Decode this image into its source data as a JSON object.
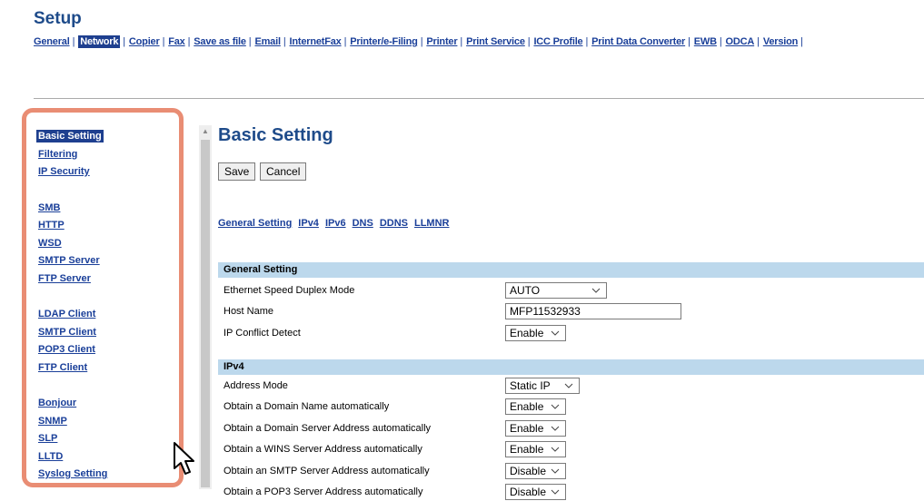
{
  "setup_title": "Setup",
  "top_nav": [
    {
      "label": "General",
      "active": false
    },
    {
      "label": "Network",
      "active": true
    },
    {
      "label": "Copier",
      "active": false
    },
    {
      "label": "Fax",
      "active": false
    },
    {
      "label": "Save as file",
      "active": false
    },
    {
      "label": "Email",
      "active": false
    },
    {
      "label": "InternetFax",
      "active": false
    },
    {
      "label": "Printer/e-Filing",
      "active": false
    },
    {
      "label": "Printer",
      "active": false
    },
    {
      "label": "Print Service",
      "active": false
    },
    {
      "label": "ICC Profile",
      "active": false
    },
    {
      "label": "Print Data Converter",
      "active": false
    },
    {
      "label": "EWB",
      "active": false
    },
    {
      "label": "ODCA",
      "active": false
    },
    {
      "label": "Version",
      "active": false
    }
  ],
  "sidebar_groups": [
    [
      "Basic Setting",
      "Filtering",
      "IP Security"
    ],
    [
      "SMB",
      "HTTP",
      "WSD",
      "SMTP Server",
      "FTP Server"
    ],
    [
      "LDAP Client",
      "SMTP Client",
      "POP3 Client",
      "FTP Client"
    ],
    [
      "Bonjour",
      "SNMP",
      "SLP",
      "LLTD",
      "Syslog Setting"
    ]
  ],
  "sidebar_active": "Basic Setting",
  "main": {
    "title": "Basic Setting",
    "save_label": "Save",
    "cancel_label": "Cancel",
    "sub_nav": [
      "General Setting",
      "IPv4",
      "IPv6",
      "DNS",
      "DDNS",
      "LLMNR"
    ]
  },
  "general_setting": {
    "header": "General Setting",
    "ethernet_label": "Ethernet Speed Duplex Mode",
    "ethernet_value": "AUTO",
    "host_label": "Host Name",
    "host_value": "MFP11532933",
    "ip_conflict_label": "IP Conflict Detect",
    "ip_conflict_value": "Enable"
  },
  "ipv4": {
    "header": "IPv4",
    "rows": [
      {
        "label": "Address Mode",
        "value": "Static IP"
      },
      {
        "label": "Obtain a Domain Name automatically",
        "value": "Enable"
      },
      {
        "label": "Obtain a Domain Server Address automatically",
        "value": "Enable"
      },
      {
        "label": "Obtain a WINS Server Address automatically",
        "value": "Enable"
      },
      {
        "label": "Obtain an SMTP Server Address automatically",
        "value": "Disable"
      },
      {
        "label": "Obtain a POP3 Server Address automatically",
        "value": "Disable"
      }
    ]
  },
  "colors": {
    "link": "#1a3f99",
    "active_bg": "#1e3f8f",
    "section_bar": "#bcd8ec",
    "highlight_frame": "#e98d74"
  },
  "icons": [
    "chevron-down-icon",
    "scroll-up-icon",
    "mouse-pointer-icon"
  ]
}
